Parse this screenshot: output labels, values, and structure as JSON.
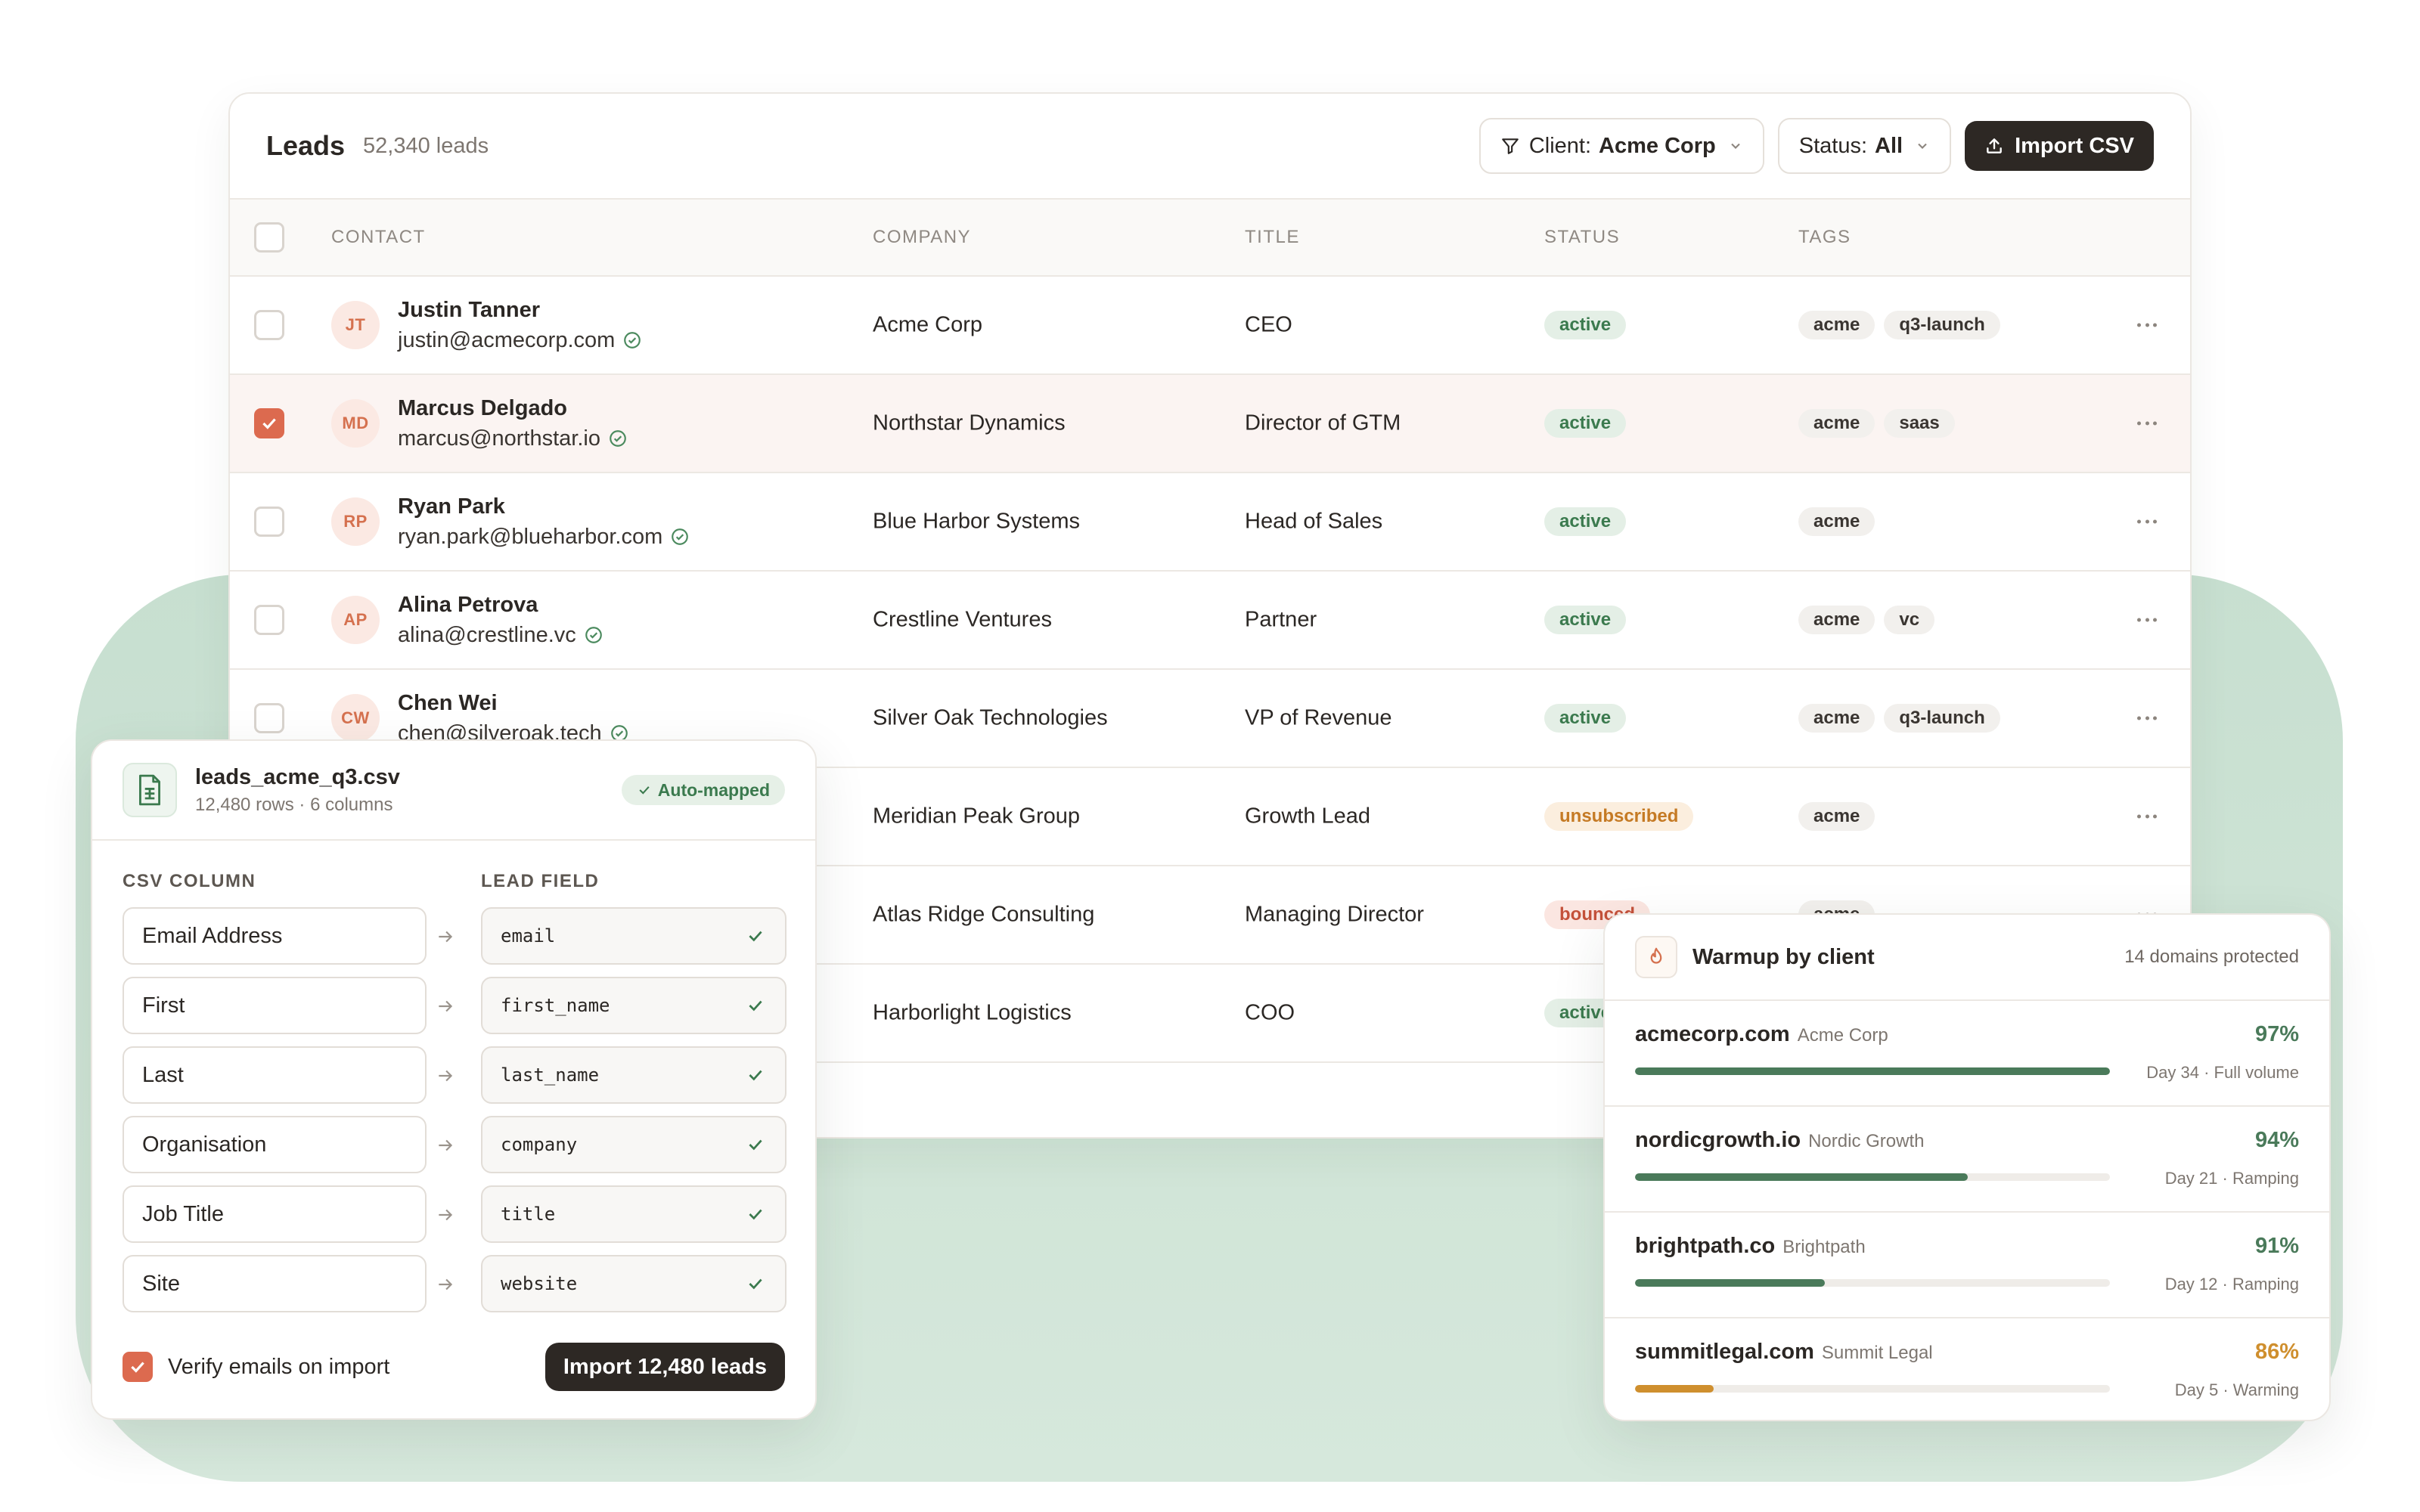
{
  "leads": {
    "title": "Leads",
    "count": "52,340 leads",
    "filters": [
      {
        "label": "Client:",
        "value": "Acme Corp"
      },
      {
        "label": "Status:",
        "value": "All"
      }
    ],
    "import_button": "Import CSV",
    "columns": [
      "CONTACT",
      "COMPANY",
      "TITLE",
      "STATUS",
      "TAGS"
    ],
    "rows": [
      {
        "initials": "JT",
        "name": "Justin Tanner",
        "email": "justin@acmecorp.com",
        "company": "Acme Corp",
        "title": "CEO",
        "status": "active",
        "tags": [
          "acme",
          "q3-launch"
        ],
        "checked": false
      },
      {
        "initials": "MD",
        "name": "Marcus Delgado",
        "email": "marcus@northstar.io",
        "company": "Northstar Dynamics",
        "title": "Director of GTM",
        "status": "active",
        "tags": [
          "acme",
          "saas"
        ],
        "checked": true
      },
      {
        "initials": "RP",
        "name": "Ryan Park",
        "email": "ryan.park@blueharbor.com",
        "company": "Blue Harbor Systems",
        "title": "Head of Sales",
        "status": "active",
        "tags": [
          "acme"
        ],
        "checked": false
      },
      {
        "initials": "AP",
        "name": "Alina Petrova",
        "email": "alina@crestline.vc",
        "company": "Crestline Ventures",
        "title": "Partner",
        "status": "active",
        "tags": [
          "acme",
          "vc"
        ],
        "checked": false
      },
      {
        "initials": "CW",
        "name": "Chen Wei",
        "email": "chen@silveroak.tech",
        "company": "Silver Oak Technologies",
        "title": "VP of Revenue",
        "status": "active",
        "tags": [
          "acme",
          "q3-launch"
        ],
        "checked": false
      },
      {
        "initials": "",
        "name": "",
        "email": "",
        "company": "Meridian Peak Group",
        "title": "Growth Lead",
        "status": "unsubscribed",
        "tags": [
          "acme"
        ],
        "checked": false
      },
      {
        "initials": "",
        "name": "",
        "email": "",
        "company": "Atlas Ridge Consulting",
        "title": "Managing Director",
        "status": "bounced",
        "tags": [
          "acme"
        ],
        "checked": false
      },
      {
        "initials": "",
        "name": "",
        "email": "",
        "company": "Harborlight Logistics",
        "title": "COO",
        "status": "active",
        "tags": [],
        "checked": false
      }
    ]
  },
  "csv_import": {
    "file_name": "leads_acme_q3.csv",
    "file_meta": "12,480 rows · 6 columns",
    "badge": "Auto-mapped",
    "col_header_source": "CSV COLUMN",
    "col_header_target": "LEAD FIELD",
    "mappings": [
      {
        "source": "Email Address",
        "target": "email"
      },
      {
        "source": "First",
        "target": "first_name"
      },
      {
        "source": "Last",
        "target": "last_name"
      },
      {
        "source": "Organisation",
        "target": "company"
      },
      {
        "source": "Job Title",
        "target": "title"
      },
      {
        "source": "Site",
        "target": "website"
      }
    ],
    "verify_label": "Verify emails on import",
    "verify_checked": true,
    "import_button": "Import 12,480 leads"
  },
  "warmup": {
    "title": "Warmup by client",
    "note": "14 domains protected",
    "items": [
      {
        "domain": "acmecorp.com",
        "client": "Acme Corp",
        "percent": "97%",
        "progress": 1.0,
        "detail": "Day 34 · Full volume",
        "color": "#4a7a5a"
      },
      {
        "domain": "nordicgrowth.io",
        "client": "Nordic Growth",
        "percent": "94%",
        "progress": 0.7,
        "detail": "Day 21 · Ramping",
        "color": "#4a7a5a"
      },
      {
        "domain": "brightpath.co",
        "client": "Brightpath",
        "percent": "91%",
        "progress": 0.4,
        "detail": "Day 12 · Ramping",
        "color": "#4a7a5a"
      },
      {
        "domain": "summitlegal.com",
        "client": "Summit Legal",
        "percent": "86%",
        "progress": 0.165,
        "detail": "Day 5 · Warming",
        "color": "#cf8f2e"
      }
    ]
  },
  "colors": {
    "accent": "#dc6a4f",
    "backdrop": "#cfe4d6",
    "primary_button": "#2d2824",
    "active_green": "#3b7a4e",
    "warming_amber": "#cf8f2e"
  },
  "icons": [
    "filter-icon",
    "chevron-down-icon",
    "upload-icon",
    "verified-check-icon",
    "more-dots-icon",
    "spreadsheet-file-icon",
    "check-icon",
    "arrow-right-icon",
    "flame-icon"
  ]
}
